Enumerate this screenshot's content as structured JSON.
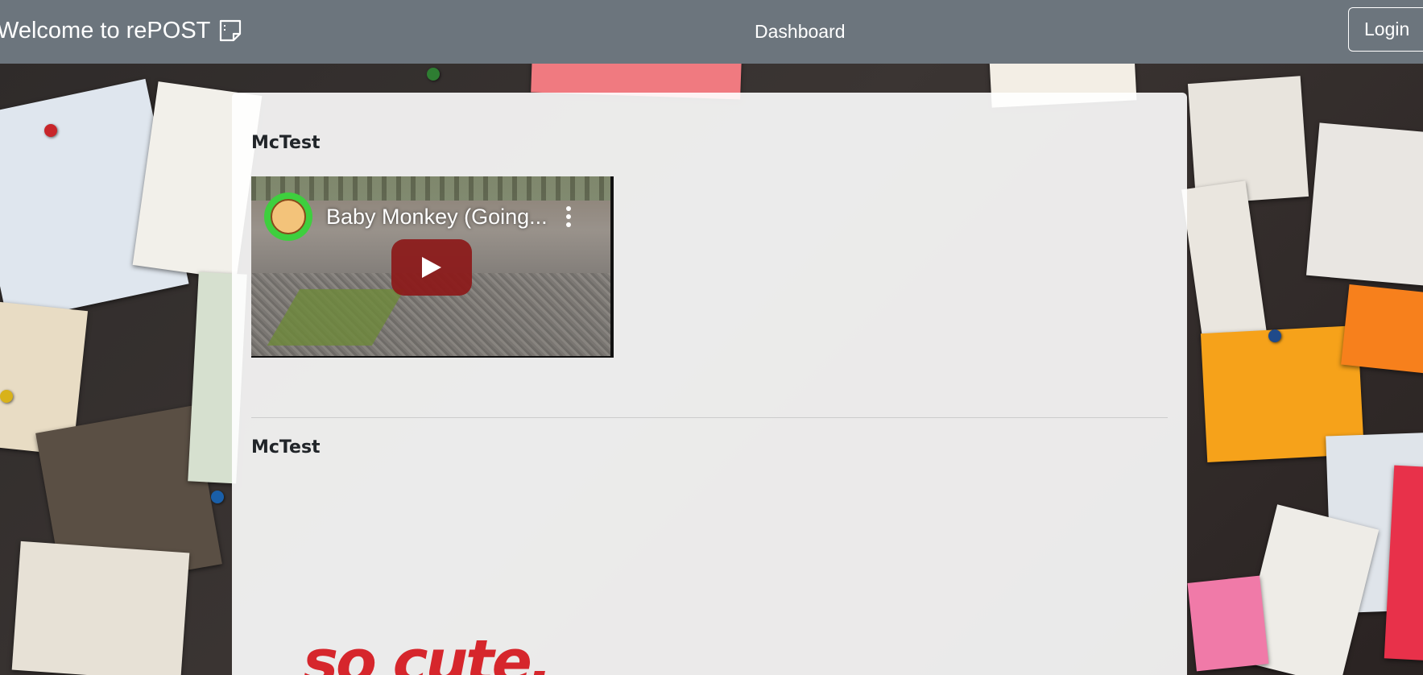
{
  "navbar": {
    "brand": "Welcome to rePOST",
    "brand_icon": "sticky-note-icon",
    "dashboard_link": "Dashboard",
    "login_button": "Login"
  },
  "posts": [
    {
      "author": "McTest",
      "type": "video",
      "video": {
        "title": "Baby Monkey (Going...",
        "channel_icon": "channel-avatar-icon",
        "menu_icon": "more-vertical-icon",
        "play_icon": "youtube-play-icon"
      }
    },
    {
      "author": "McTest",
      "type": "image",
      "image_text": "so cute."
    }
  ],
  "colors": {
    "navbar_bg": "#6c757d",
    "card_bg": "#ffffff",
    "play_button": "#8c1919",
    "image_text": "#d6262c"
  }
}
